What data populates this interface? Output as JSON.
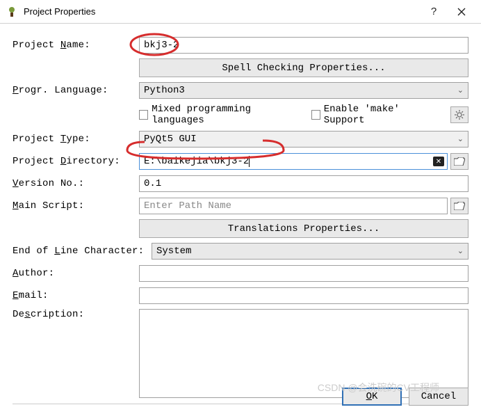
{
  "window": {
    "title": "Project Properties"
  },
  "labels": {
    "project_name": "Project Name:",
    "progr_language": "Progr. Language:",
    "project_type": "Project Type:",
    "project_directory": "Project Directory:",
    "version_no": "Version No.:",
    "main_script": "Main Script:",
    "eol": "End of Line Character:",
    "author": "Author:",
    "email": "Email:",
    "description": "Description:"
  },
  "values": {
    "project_name": "bkj3-2",
    "language": "Python3",
    "project_type": "PyQt5 GUI",
    "project_directory": "E:\\baikejia\\bkj3-2",
    "version_no": "0.1",
    "main_script_placeholder": "Enter Path Name",
    "eol": "System"
  },
  "buttons": {
    "spell": "Spell Checking Properties...",
    "translations": "Translations Properties...",
    "ok": "OK",
    "cancel": "Cancel"
  },
  "checkboxes": {
    "mixed": "Mixed programming languages",
    "make": "Enable 'make' Support"
  },
  "watermark": "CSDN @会洗碗的CV工程师"
}
